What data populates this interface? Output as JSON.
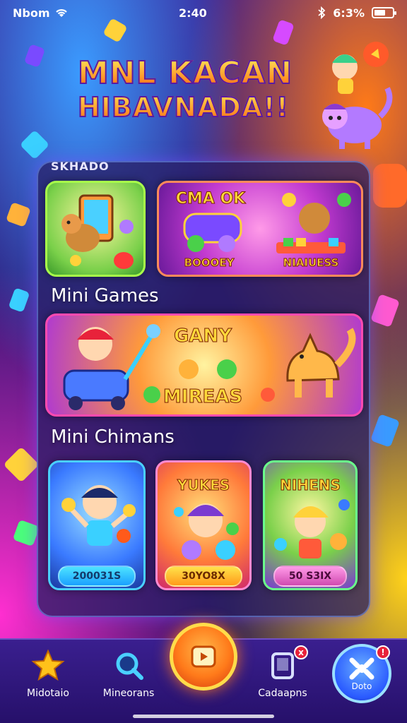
{
  "status_bar": {
    "carrier": "Nbom",
    "time": "2:40",
    "battery_text": "6:3%",
    "battery_level": 0.63
  },
  "hero": {
    "line1": "MNL KACAN",
    "line2": "HIBAVNADA!!"
  },
  "top_section": {
    "label": "SKHADO",
    "cards": [
      {
        "label": ""
      },
      {
        "label_title": "CMA OK",
        "label_left": "BOOOEY",
        "label_right": "NIAIUESS"
      }
    ]
  },
  "mini_games": {
    "title": "Mini Games",
    "banner": {
      "title": "GANY",
      "subtitle": "MIREAS"
    }
  },
  "mini_chimans": {
    "title": "Mini Chimans",
    "cards": [
      {
        "title": "",
        "pill": "200031S"
      },
      {
        "title": "YUKES",
        "pill": "30YO8X"
      },
      {
        "title": "NIHENS",
        "pill": "50 S3IX"
      }
    ]
  },
  "bottom_nav": {
    "items": [
      {
        "label": "Midotaio",
        "icon": "star-icon"
      },
      {
        "label": "Mineorans",
        "icon": "magnifier-icon"
      },
      {
        "label": "",
        "icon": "play-icon"
      },
      {
        "label": "Cadaapns",
        "icon": "phone-icon",
        "badge": "x"
      },
      {
        "label": "Doto",
        "icon": "controller-icon",
        "badge": "!"
      }
    ]
  },
  "colors": {
    "accent_orange": "#ff7a1a",
    "accent_yellow": "#ffd83a",
    "accent_cyan": "#1aa0ff",
    "panel_bg": "#281e64"
  }
}
